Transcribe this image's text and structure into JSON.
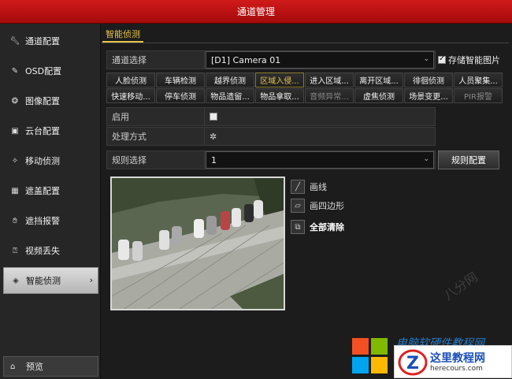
{
  "window": {
    "title": "通道管理"
  },
  "sidebar": {
    "items": [
      {
        "label": "通道配置",
        "icon": "wrench-icon"
      },
      {
        "label": "OSD配置",
        "icon": "edit-icon"
      },
      {
        "label": "图像配置",
        "icon": "palette-icon"
      },
      {
        "label": "云台配置",
        "icon": "ptz-icon"
      },
      {
        "label": "移动侦测",
        "icon": "running-icon"
      },
      {
        "label": "遮盖配置",
        "icon": "mask-icon"
      },
      {
        "label": "遮挡报警",
        "icon": "hand-icon"
      },
      {
        "label": "视频丢失",
        "icon": "video-loss-icon"
      },
      {
        "label": "智能侦测",
        "icon": "shield-icon",
        "active": true
      }
    ],
    "bottom": {
      "label": "预览",
      "icon": "home-icon"
    }
  },
  "main": {
    "tab": "智能侦测",
    "channel": {
      "label": "通道选择",
      "value": "[D1] Camera 01"
    },
    "store_smart_picture": {
      "label": "存储智能图片",
      "checked": true
    },
    "detect_buttons_row1": [
      "人脸侦测",
      "车辆检测",
      "越界侦测",
      "区域入侵...",
      "进入区域...",
      "离开区域...",
      "徘徊侦测",
      "人员聚集..."
    ],
    "detect_buttons_row2": [
      "快速移动...",
      "停车侦测",
      "物品遗留...",
      "物品拿取...",
      "音频异常...",
      "虚焦侦测",
      "场景变更...",
      "PIR报警"
    ],
    "selected_detect": "区域入侵...",
    "disabled_detect": [
      "音频异常...",
      "PIR报警"
    ],
    "enable": {
      "label": "启用",
      "checked": false
    },
    "handle": {
      "label": "处理方式",
      "icon": "gear-icon"
    },
    "rule": {
      "label": "规则选择",
      "value": "1",
      "config_button": "规则配置"
    },
    "tools": [
      {
        "label": "画线",
        "icon": "pencil-icon"
      },
      {
        "label": "画四边形",
        "icon": "polygon-icon"
      },
      {
        "label": "全部清除",
        "icon": "clear-icon"
      }
    ]
  },
  "watermarks": {
    "site_cursive": "电脑软硬件教程网",
    "brand_name": "这里教程网",
    "brand_url": "herecours.com",
    "diag": "八分网"
  }
}
